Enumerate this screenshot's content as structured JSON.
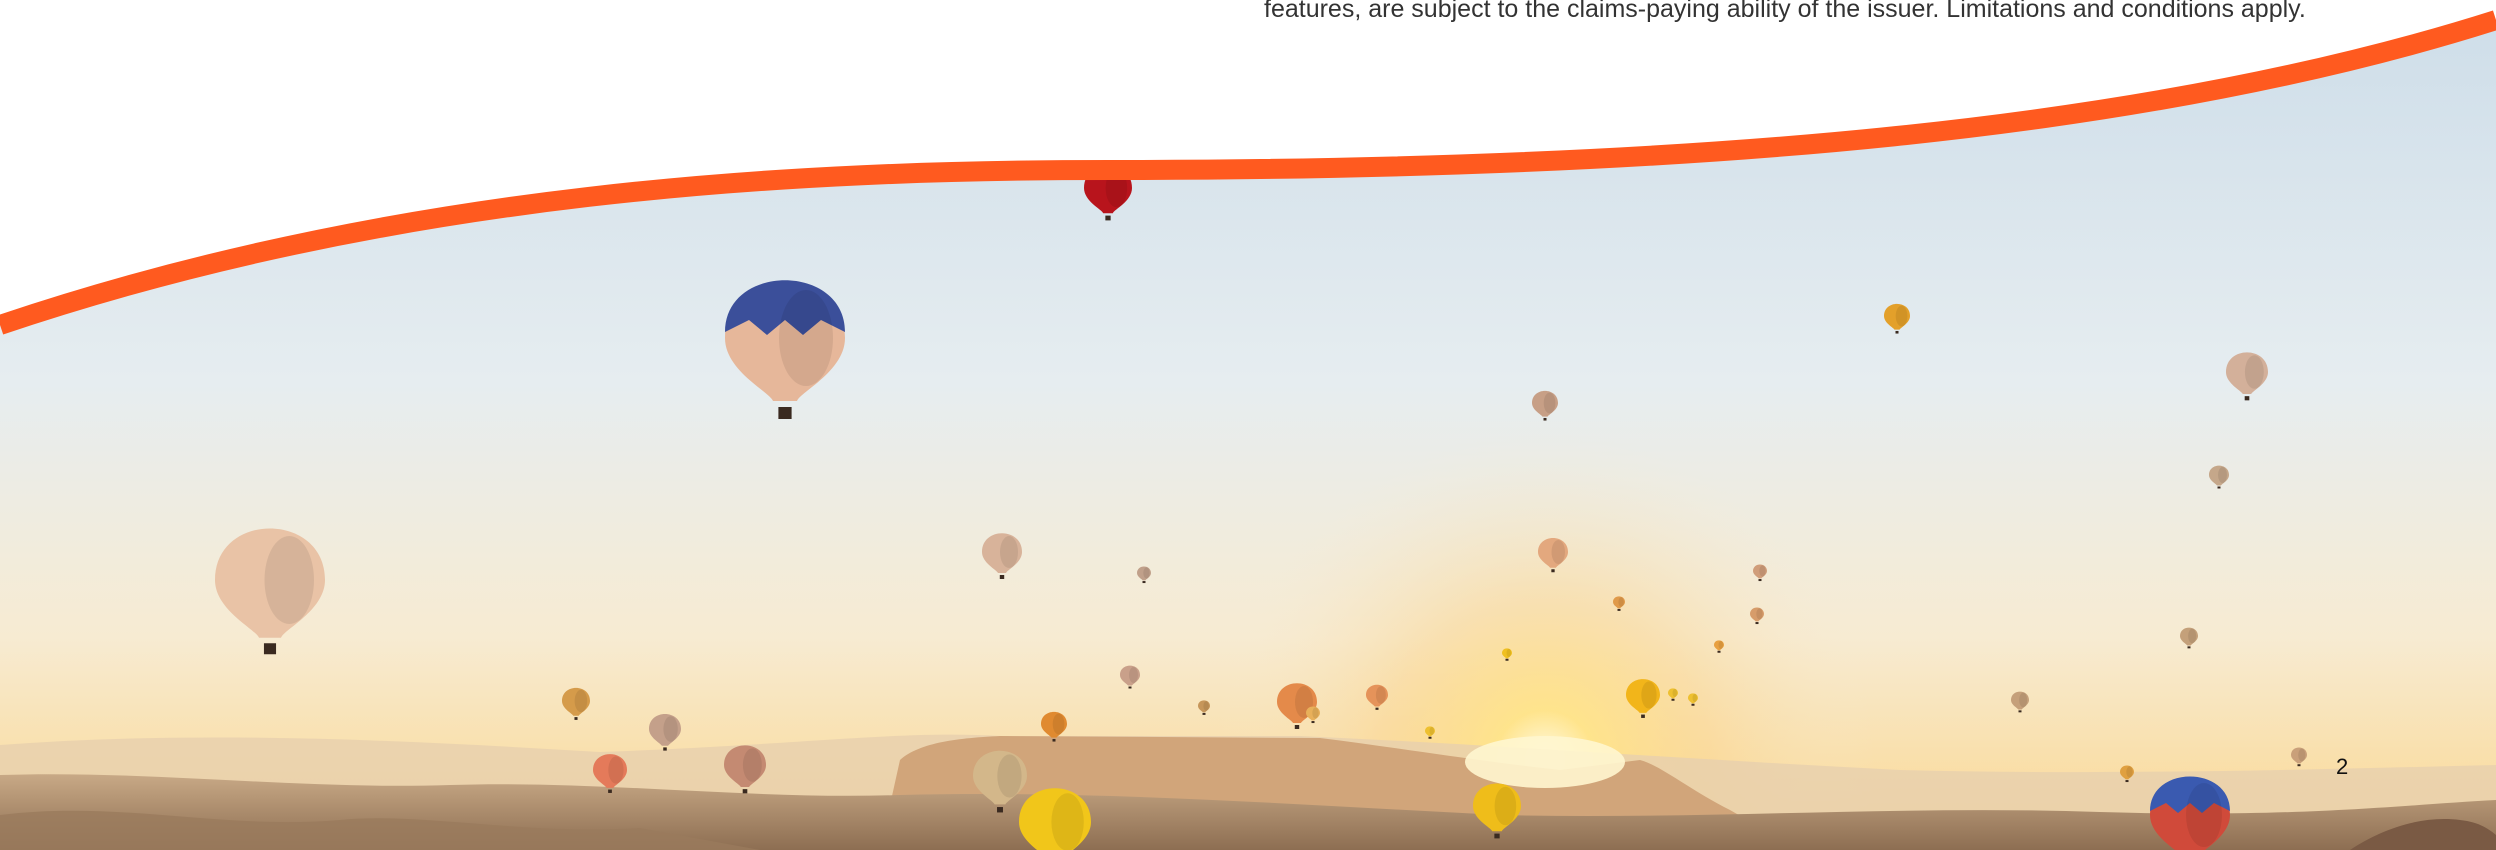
{
  "disclaimer": {
    "text": "features, are subject to the claims-paying ability of the issuer. Limitations and conditions apply."
  },
  "page": {
    "number": "2"
  },
  "colors": {
    "accent_swoosh": "#ff5a1f",
    "sky_top": "#d4e3ee",
    "sky_horizon": "#fbe6b8",
    "sun_glow": "#fff3c4",
    "ground": "#b89a78"
  },
  "photo": {
    "subject": "hot-air-balloons-over-valley-at-sunrise"
  }
}
